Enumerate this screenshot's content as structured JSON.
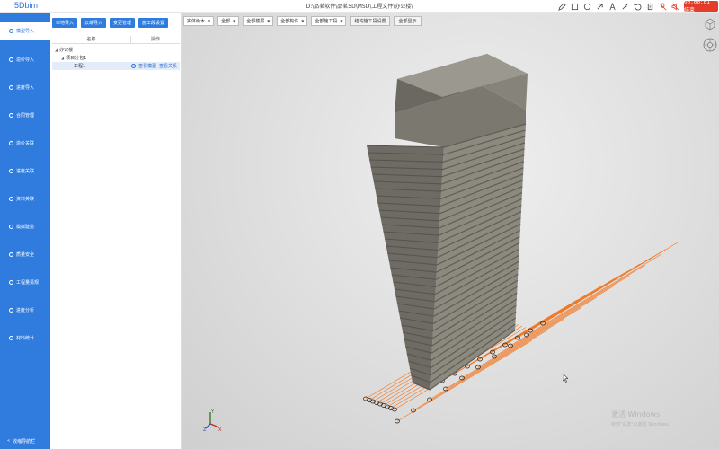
{
  "app": {
    "logo": "5Dbim",
    "path": "D:\\品茗软件\\品茗5D\\MSD\\工程文件\\办公楼\\",
    "timer": "00:00:01 结束"
  },
  "toolbar_icons": [
    "pen-icon",
    "rectangle-icon",
    "circle-icon",
    "arrow-icon",
    "text-icon",
    "brush-icon",
    "undo-icon",
    "clear-icon",
    "mic-muted-icon",
    "speaker-muted-icon"
  ],
  "sidebar": {
    "items": [
      {
        "label": "模型导入",
        "icon": "model-import-icon"
      },
      {
        "label": "造价导入",
        "icon": "cost-import-icon"
      },
      {
        "label": "进度导入",
        "icon": "schedule-import-icon"
      },
      {
        "label": "合同管理",
        "icon": "contract-icon"
      },
      {
        "label": "造价关联",
        "icon": "cost-link-icon"
      },
      {
        "label": "进度关联",
        "icon": "schedule-link-icon"
      },
      {
        "label": "资料关联",
        "icon": "document-link-icon"
      },
      {
        "label": "模拟建造",
        "icon": "simulation-icon"
      },
      {
        "label": "质量安全",
        "icon": "quality-safety-icon"
      },
      {
        "label": "工程量清规",
        "icon": "quantity-icon"
      },
      {
        "label": "进度分析",
        "icon": "schedule-analysis-icon"
      },
      {
        "label": "材料统计",
        "icon": "material-icon"
      }
    ],
    "collapse": "收缩导航栏"
  },
  "panel": {
    "buttons": [
      "本地导入",
      "云端导入",
      "变更管理",
      "施工段设置"
    ],
    "col_name": "名称",
    "col_op": "操作",
    "tree": [
      {
        "label": "办公楼",
        "level": 0
      },
      {
        "label": "项目分包1",
        "level": 1
      },
      {
        "label": "工程1",
        "level": 2,
        "ops": [
          "查看模型",
          "查看关系"
        ]
      }
    ]
  },
  "filters": [
    {
      "label": "实体树木",
      "options": true
    },
    {
      "label": "全部",
      "options": true
    },
    {
      "label": "全部楼层",
      "options": true
    },
    {
      "label": "全部构件",
      "options": true
    },
    {
      "label": "全部施工段",
      "options": true
    }
  ],
  "filter_buttons": [
    "结构施工段设置",
    "全部显示"
  ],
  "viewport": {
    "axis": {
      "x": "X",
      "y": "Y",
      "z": "Z"
    },
    "watermark_title": "激活 Windows",
    "watermark_sub": "转到\"设置\"以激活 Windows。"
  }
}
